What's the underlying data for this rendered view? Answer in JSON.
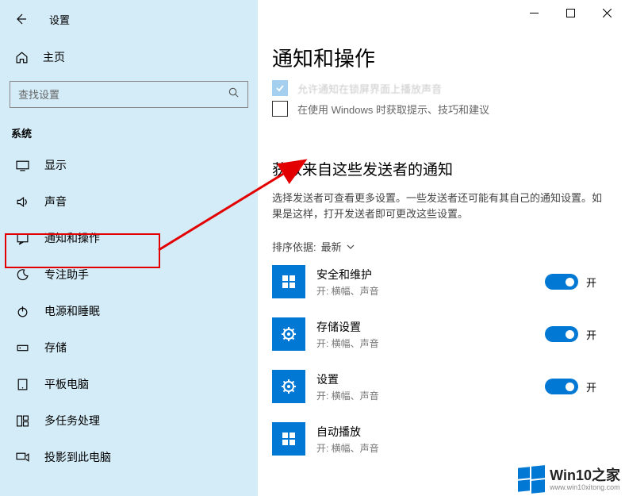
{
  "window": {
    "title": "设置"
  },
  "sidebar": {
    "home": "主页",
    "search_placeholder": "查找设置",
    "section": "系统",
    "items": [
      {
        "label": "显示"
      },
      {
        "label": "声音"
      },
      {
        "label": "通知和操作"
      },
      {
        "label": "专注助手"
      },
      {
        "label": "电源和睡眠"
      },
      {
        "label": "存储"
      },
      {
        "label": "平板电脑"
      },
      {
        "label": "多任务处理"
      },
      {
        "label": "投影到此电脑"
      }
    ]
  },
  "main": {
    "page_title": "通知和操作",
    "checkbox2_label": "在使用 Windows 时获取提示、技巧和建议",
    "section_title": "获取来自这些发送者的通知",
    "section_desc": "选择发送者可查看更多设置。一些发送者还可能有其自己的通知设置。如果是这样，打开发送者即可更改这些设置。",
    "sort_label": "排序依据:",
    "sort_value": "最新",
    "on_label": "开",
    "senders": [
      {
        "name": "安全和维护",
        "sub": "开: 横幅、声音",
        "icon": "shield"
      },
      {
        "name": "存储设置",
        "sub": "开: 横幅、声音",
        "icon": "gear"
      },
      {
        "name": "设置",
        "sub": "开: 横幅、声音",
        "icon": "gear"
      },
      {
        "name": "自动播放",
        "sub": "开: 横幅、声音",
        "icon": "shield"
      }
    ]
  },
  "watermark": {
    "main": "Win10之家",
    "sub": "www.win10xitong.com"
  }
}
